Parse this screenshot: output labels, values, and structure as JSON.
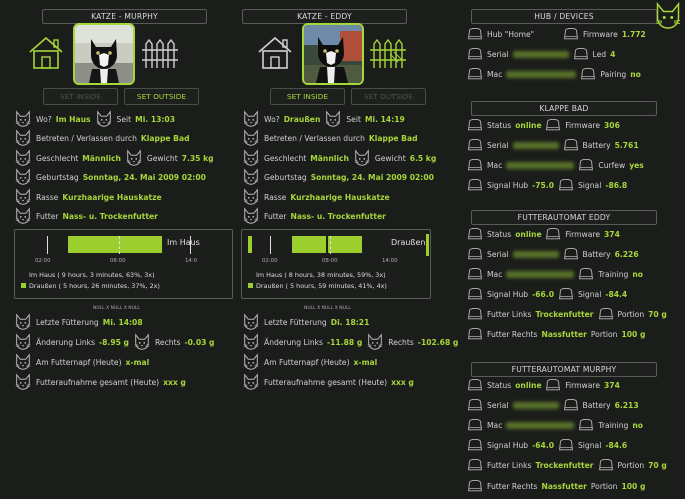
{
  "murphy": {
    "title": "KATZE - MURPHY",
    "btn_inside": "SET INSIDE",
    "btn_outside": "SET OUTSIDE",
    "wo_label": "Wo?",
    "wo_value": "Im Haus",
    "seit_label": "Seit",
    "seit_value": "Mi. 13:03",
    "betreten_label": "Betreten / Verlassen durch",
    "betreten_value": "Klappe Bad",
    "geschlecht_label": "Geschlecht",
    "geschlecht_value": "Männlich",
    "gewicht_label": "Gewicht",
    "gewicht_value": "7.35 kg",
    "geburtstag_label": "Geburtstag",
    "geburtstag_value": "Sonntag, 24. Mai 2009 02:00",
    "rasse_label": "Rasse",
    "rasse_value": "Kurzhaarige Hauskatze",
    "futter_label": "Futter",
    "futter_value": "Nass- u. Trockenfutter",
    "chart_state": "Im Haus",
    "tick1": "02:00",
    "tick2": "08:00",
    "tick3": "14:0",
    "legend1": "Im Haus ( 9 hours, 3 minutes, 63%, 3x)",
    "legend2": "Draußen ( 5 hours, 26 minutes, 37%, 2x)",
    "null_label": "NULL X NULL X NULL",
    "fuetterung_label": "Letzte Fütterung",
    "fuetterung_value": "Mi. 14:08",
    "aenderung_label": "Änderung Links",
    "aenderung_links": "-8.95 g",
    "rechts_label": "Rechts",
    "rechts_value": "-0.03 g",
    "napf_label": "Am Futternapf (Heute)",
    "napf_value": "x-mal",
    "aufnahme_label": "Futteraufnahme gesamt (Heute)",
    "aufnahme_value": "xxx g"
  },
  "eddy": {
    "title": "KATZE - EDDY",
    "btn_inside": "SET INSIDE",
    "btn_outside": "SET OUTSIDE",
    "wo_label": "Wo?",
    "wo_value": "Draußen",
    "seit_label": "Seit",
    "seit_value": "Mi. 14:19",
    "betreten_label": "Betreten / Verlassen durch",
    "betreten_value": "Klappe Bad",
    "geschlecht_label": "Geschlecht",
    "geschlecht_value": "Männlich",
    "gewicht_label": "Gewicht",
    "gewicht_value": "6.5 kg",
    "geburtstag_label": "Geburtstag",
    "geburtstag_value": "Sonntag, 24. Mai 2009 02:00",
    "rasse_label": "Rasse",
    "rasse_value": "Kurzhaarige Hauskatze",
    "futter_label": "Futter",
    "futter_value": "Nass- u. Trockenfutter",
    "chart_state": "Draußen",
    "tick1": "02:00",
    "tick2": "08:00",
    "tick3": "14:00",
    "legend1": "Im Haus ( 8 hours, 38 minutes, 59%, 3x)",
    "legend2": "Draußen ( 5 hours, 59 minutes, 41%, 4x)",
    "null_label": "NULL X NULL X NULL",
    "fuetterung_label": "Letzte Fütterung",
    "fuetterung_value": "Di. 18:21",
    "aenderung_label": "Änderung Links",
    "aenderung_links": "-11.88 g",
    "rechts_label": "Rechts",
    "rechts_value": "-102.68 g",
    "napf_label": "Am Futternapf (Heute)",
    "napf_value": "x-mal",
    "aufnahme_label": "Futteraufnahme gesamt (Heute)",
    "aufnahme_value": "xxx g"
  },
  "hub": {
    "title": "HUB / DEVICES",
    "hub_label": "Hub \"Home\"",
    "firmware_label": "Firmware",
    "firmware_value": "1.772",
    "serial_label": "Serial",
    "led_label": "Led",
    "led_value": "4",
    "mac_label": "Mac",
    "pairing_label": "Pairing",
    "pairing_value": "no"
  },
  "klappe": {
    "title": "KLAPPE BAD",
    "status_label": "Status",
    "status_value": "online",
    "firmware_label": "Firmware",
    "firmware_value": "306",
    "serial_label": "Serial",
    "battery_label": "Battery",
    "battery_value": "5.761",
    "mac_label": "Mac",
    "curfew_label": "Curfew",
    "curfew_value": "yes",
    "signal_hub_label": "Signal Hub",
    "signal_hub_value": "-75.0",
    "signal_label": "Signal",
    "signal_value": "-86.8"
  },
  "fa_eddy": {
    "title": "FUTTERAUTOMAT EDDY",
    "status_label": "Status",
    "status_value": "online",
    "firmware_label": "Firmware",
    "firmware_value": "374",
    "serial_label": "Serial",
    "battery_label": "Battery",
    "battery_value": "6.226",
    "mac_label": "Mac",
    "training_label": "Training",
    "training_value": "no",
    "signal_hub_label": "Signal Hub",
    "signal_hub_value": "-66.0",
    "signal_label": "Signal",
    "signal_value": "-84.4",
    "links_label": "Futter Links",
    "links_value": "Trockenfutter",
    "portion_label": "Portion",
    "portion_links": "70 g",
    "rechts_label": "Futter Rechts",
    "rechts_value": "Nassfutter",
    "portion_rechts": "100 g"
  },
  "fa_murphy": {
    "title": "FUTTERAUTOMAT MURPHY",
    "status_label": "Status",
    "status_value": "online",
    "firmware_label": "Firmware",
    "firmware_value": "374",
    "serial_label": "Serial",
    "battery_label": "Battery",
    "battery_value": "6.213",
    "mac_label": "Mac",
    "training_label": "Training",
    "training_value": "no",
    "signal_hub_label": "Signal Hub",
    "signal_hub_value": "-64.0",
    "signal_label": "Signal",
    "signal_value": "-84.6",
    "links_label": "Futter Links",
    "links_value": "Trockenfutter",
    "portion_label": "Portion",
    "portion_links": "70 g",
    "rechts_label": "Futter Rechts",
    "rechts_value": "Nassfutter",
    "portion_rechts": "100 g"
  },
  "colors": {
    "accent": "#a6d63a",
    "background": "#1b1d1b",
    "border": "#5a5c5a"
  }
}
